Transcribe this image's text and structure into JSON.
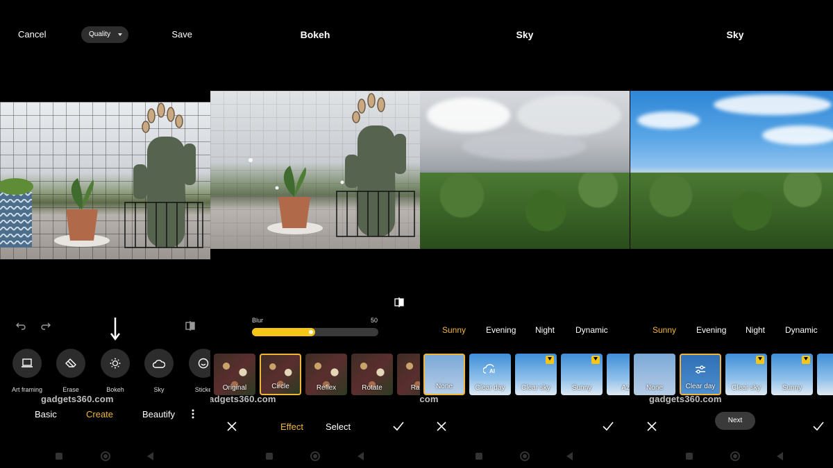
{
  "panel1": {
    "cancel": "Cancel",
    "quality": "Quality",
    "save": "Save",
    "tools": [
      {
        "label": "Art framing",
        "icon": "art-framing-icon"
      },
      {
        "label": "Erase",
        "icon": "eraser-icon"
      },
      {
        "label": "Bokeh",
        "icon": "bokeh-icon"
      },
      {
        "label": "Sky",
        "icon": "cloud-icon"
      },
      {
        "label": "Sticke",
        "icon": "sticker-icon"
      }
    ],
    "modes": [
      "Basic",
      "Create",
      "Beautify"
    ],
    "active_mode": "Create"
  },
  "panel2": {
    "title": "Bokeh",
    "blur_label": "Blur",
    "blur_value": "50",
    "blur_fraction": 0.5,
    "effects": [
      "Original",
      "Circle",
      "Reflex",
      "Rotate",
      "Radi"
    ],
    "selected_effect": "Circle",
    "tabs": [
      "Effect",
      "Select"
    ],
    "active_tab": "Effect"
  },
  "panel3": {
    "title": "Sky",
    "tabs": [
      "Sunny",
      "Evening",
      "Night",
      "Dynamic"
    ],
    "active_tab": "Sunny",
    "skies": [
      "None",
      "Clear day",
      "Clear sky",
      "Sunny",
      "Azu"
    ],
    "selected_sky": "None"
  },
  "panel4": {
    "title": "Sky",
    "tabs": [
      "Sunny",
      "Evening",
      "Night",
      "Dynamic"
    ],
    "active_tab": "Sunny",
    "skies": [
      "None",
      "Clear day",
      "Clear sky",
      "Sunny",
      "A"
    ],
    "selected_sky": "Clear day",
    "next": "Next"
  },
  "watermark": "gadgets360.com",
  "colors": {
    "accent": "#f2b73a",
    "slider": "#f5c518",
    "button_bg": "#2c2c2c"
  }
}
